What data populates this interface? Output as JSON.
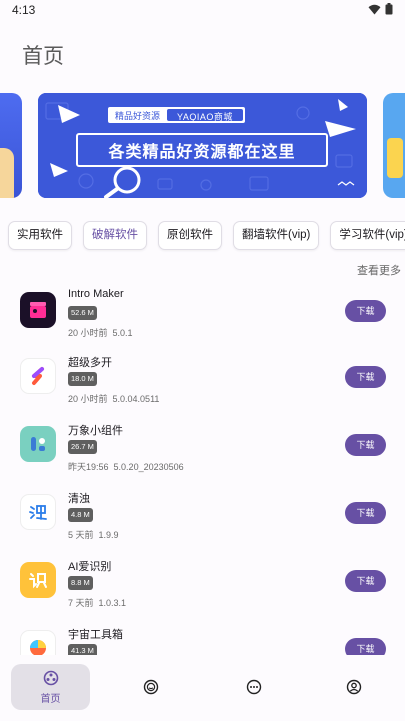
{
  "status_bar": {
    "time": "4:13"
  },
  "page_title": "首页",
  "banner": {
    "tag_left": "精品好资源",
    "tag_right": "YAQIAO商城",
    "headline": "各类精品好资源都在这里"
  },
  "categories": [
    {
      "label": "实用软件",
      "active": false
    },
    {
      "label": "破解软件",
      "active": true
    },
    {
      "label": "原创软件",
      "active": false
    },
    {
      "label": "翻墙软件(vip)",
      "active": false
    },
    {
      "label": "学习软件(vip)",
      "active": false
    }
  ],
  "more_link": "查看更多",
  "download_label": "下载",
  "apps": [
    {
      "name": "Intro Maker",
      "size": "52.6 M",
      "time": "20 小时前",
      "version": "5.0.1",
      "icon": "intro-maker-icon"
    },
    {
      "name": "超级多开",
      "size": "18.0 M",
      "time": "20 小时前",
      "version": "5.0.04.0511",
      "icon": "super-multi-icon"
    },
    {
      "name": "万象小组件",
      "size": "26.7 M",
      "time": "昨天19:56",
      "version": "5.0.20_20230506",
      "icon": "widget-icon"
    },
    {
      "name": "清浊",
      "size": "4.8 M",
      "time": "5 天前",
      "version": "1.9.9",
      "icon": "qingzhuo-icon"
    },
    {
      "name": "AI爱识别",
      "size": "8.8 M",
      "time": "7 天前",
      "version": "1.0.3.1",
      "icon": "ai-recognize-icon"
    },
    {
      "name": "宇宙工具箱",
      "size": "41.3 M",
      "time": "",
      "version": "",
      "icon": "universe-toolbox-icon"
    }
  ],
  "bottom_nav": [
    {
      "label": "首页",
      "icon": "home-icon",
      "active": true
    },
    {
      "label": "",
      "icon": "smile-icon",
      "active": false
    },
    {
      "label": "",
      "icon": "more-dots-icon",
      "active": false
    },
    {
      "label": "",
      "icon": "profile-icon",
      "active": false
    }
  ],
  "colors": {
    "accent": "#6750a4",
    "banner": "#3c58d9",
    "size_badge": "#5f5f5f"
  }
}
